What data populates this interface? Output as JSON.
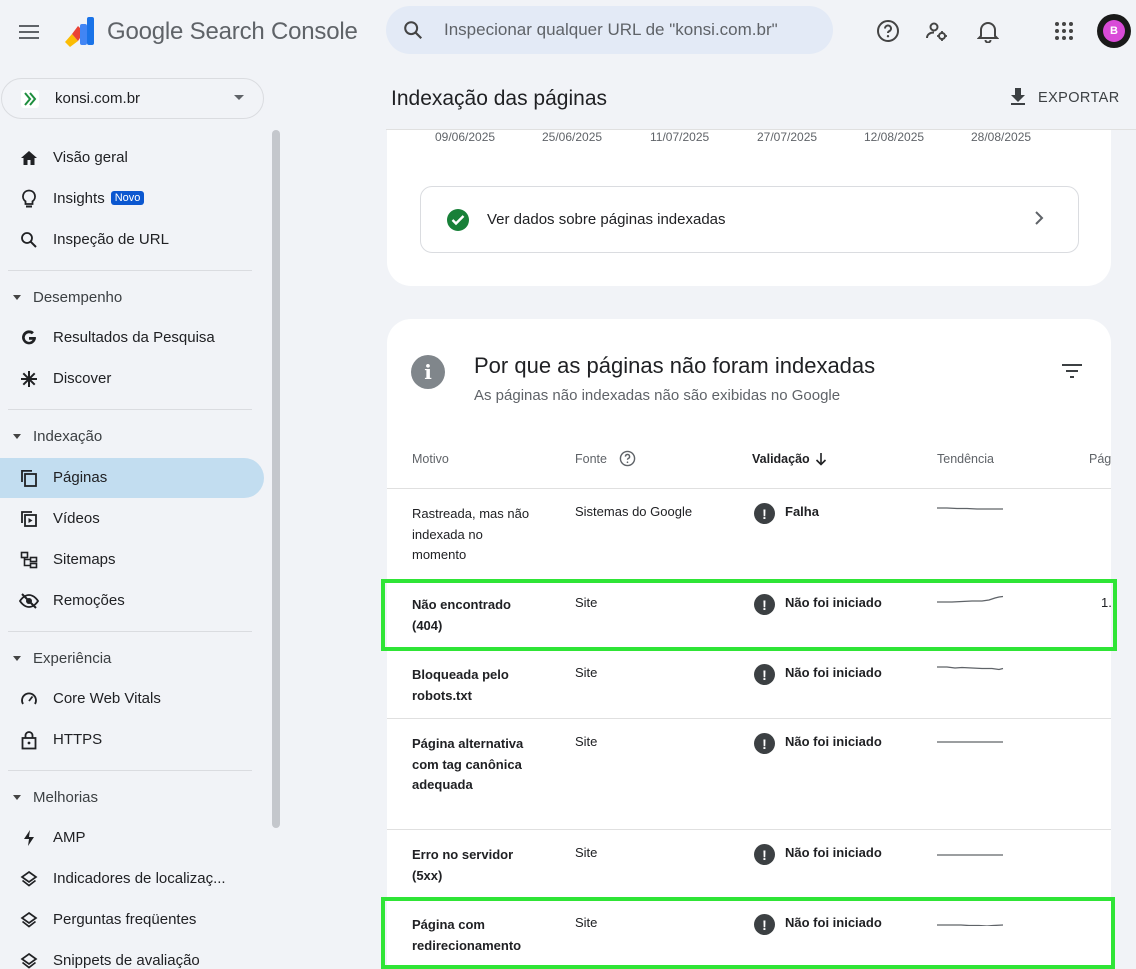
{
  "topbar": {
    "brand_google": "Google",
    "brand_product": "Search Console",
    "search_placeholder": "Inspecionar qualquer URL de \"konsi.com.br\"",
    "avatar_text": "B"
  },
  "property": {
    "name": "konsi.com.br"
  },
  "sidebar": {
    "items": [
      {
        "label": "Visão geral",
        "icon": "home-icon"
      },
      {
        "label": "Insights",
        "badge": "Novo",
        "icon": "lightbulb-icon"
      },
      {
        "label": "Inspeção de URL",
        "icon": "search-icon"
      }
    ],
    "sections": [
      {
        "label": "Desempenho",
        "items": [
          {
            "label": "Resultados da Pesquisa",
            "icon": "google-g-icon"
          },
          {
            "label": "Discover",
            "icon": "asterisk-icon"
          }
        ]
      },
      {
        "label": "Indexação",
        "items": [
          {
            "label": "Páginas",
            "icon": "pages-icon",
            "active": true
          },
          {
            "label": "Vídeos",
            "icon": "video-icon"
          },
          {
            "label": "Sitemaps",
            "icon": "sitemap-icon"
          },
          {
            "label": "Remoções",
            "icon": "eye-off-icon"
          }
        ]
      },
      {
        "label": "Experiência",
        "items": [
          {
            "label": "Core Web Vitals",
            "icon": "gauge-icon"
          },
          {
            "label": "HTTPS",
            "icon": "lock-icon"
          }
        ]
      },
      {
        "label": "Melhorias",
        "items": [
          {
            "label": "AMP",
            "icon": "bolt-icon"
          },
          {
            "label": "Indicadores de localizaç...",
            "icon": "layers-icon"
          },
          {
            "label": "Perguntas freqüentes",
            "icon": "layers-icon"
          },
          {
            "label": "Snippets de avaliação",
            "icon": "layers-icon"
          }
        ]
      }
    ]
  },
  "header": {
    "title": "Indexação das páginas",
    "export_label": "EXPORTAR"
  },
  "chart_dates": [
    "09/06/2025",
    "25/06/2025",
    "11/07/2025",
    "27/07/2025",
    "12/08/2025",
    "28/08/2025"
  ],
  "indexed_link": {
    "label": "Ver dados sobre páginas indexadas"
  },
  "not_indexed": {
    "title": "Por que as páginas não foram indexadas",
    "subtitle": "As páginas não indexadas não são exibidas no Google",
    "columns": {
      "reason": "Motivo",
      "source": "Fonte",
      "validation": "Validação",
      "trend": "Tendência",
      "pages": "Pág"
    },
    "rows": [
      {
        "reason": "Rastreada, mas não indexada no momento",
        "source": "Sistemas do Google",
        "validation": "Falha",
        "pages": "",
        "highlighted": false
      },
      {
        "reason": "Não encontrado (404)",
        "source": "Site",
        "validation": "Não foi iniciado",
        "pages": "1.",
        "highlighted": true
      },
      {
        "reason": "Bloqueada pelo robots.txt",
        "source": "Site",
        "validation": "Não foi iniciado",
        "pages": "",
        "highlighted": false
      },
      {
        "reason": "Página alternativa com tag canônica adequada",
        "source": "Site",
        "validation": "Não foi iniciado",
        "pages": "",
        "highlighted": false
      },
      {
        "reason": "Erro no servidor (5xx)",
        "source": "Site",
        "validation": "Não foi iniciado",
        "pages": "",
        "highlighted": false
      },
      {
        "reason": "Página com redirecionamento",
        "source": "Site",
        "validation": "Não foi iniciado",
        "pages": "",
        "highlighted": true
      }
    ]
  },
  "colors": {
    "accent": "#0b57d0",
    "active_nav": "#c2ddf0",
    "success": "#188038",
    "highlight": "#2fe536"
  }
}
